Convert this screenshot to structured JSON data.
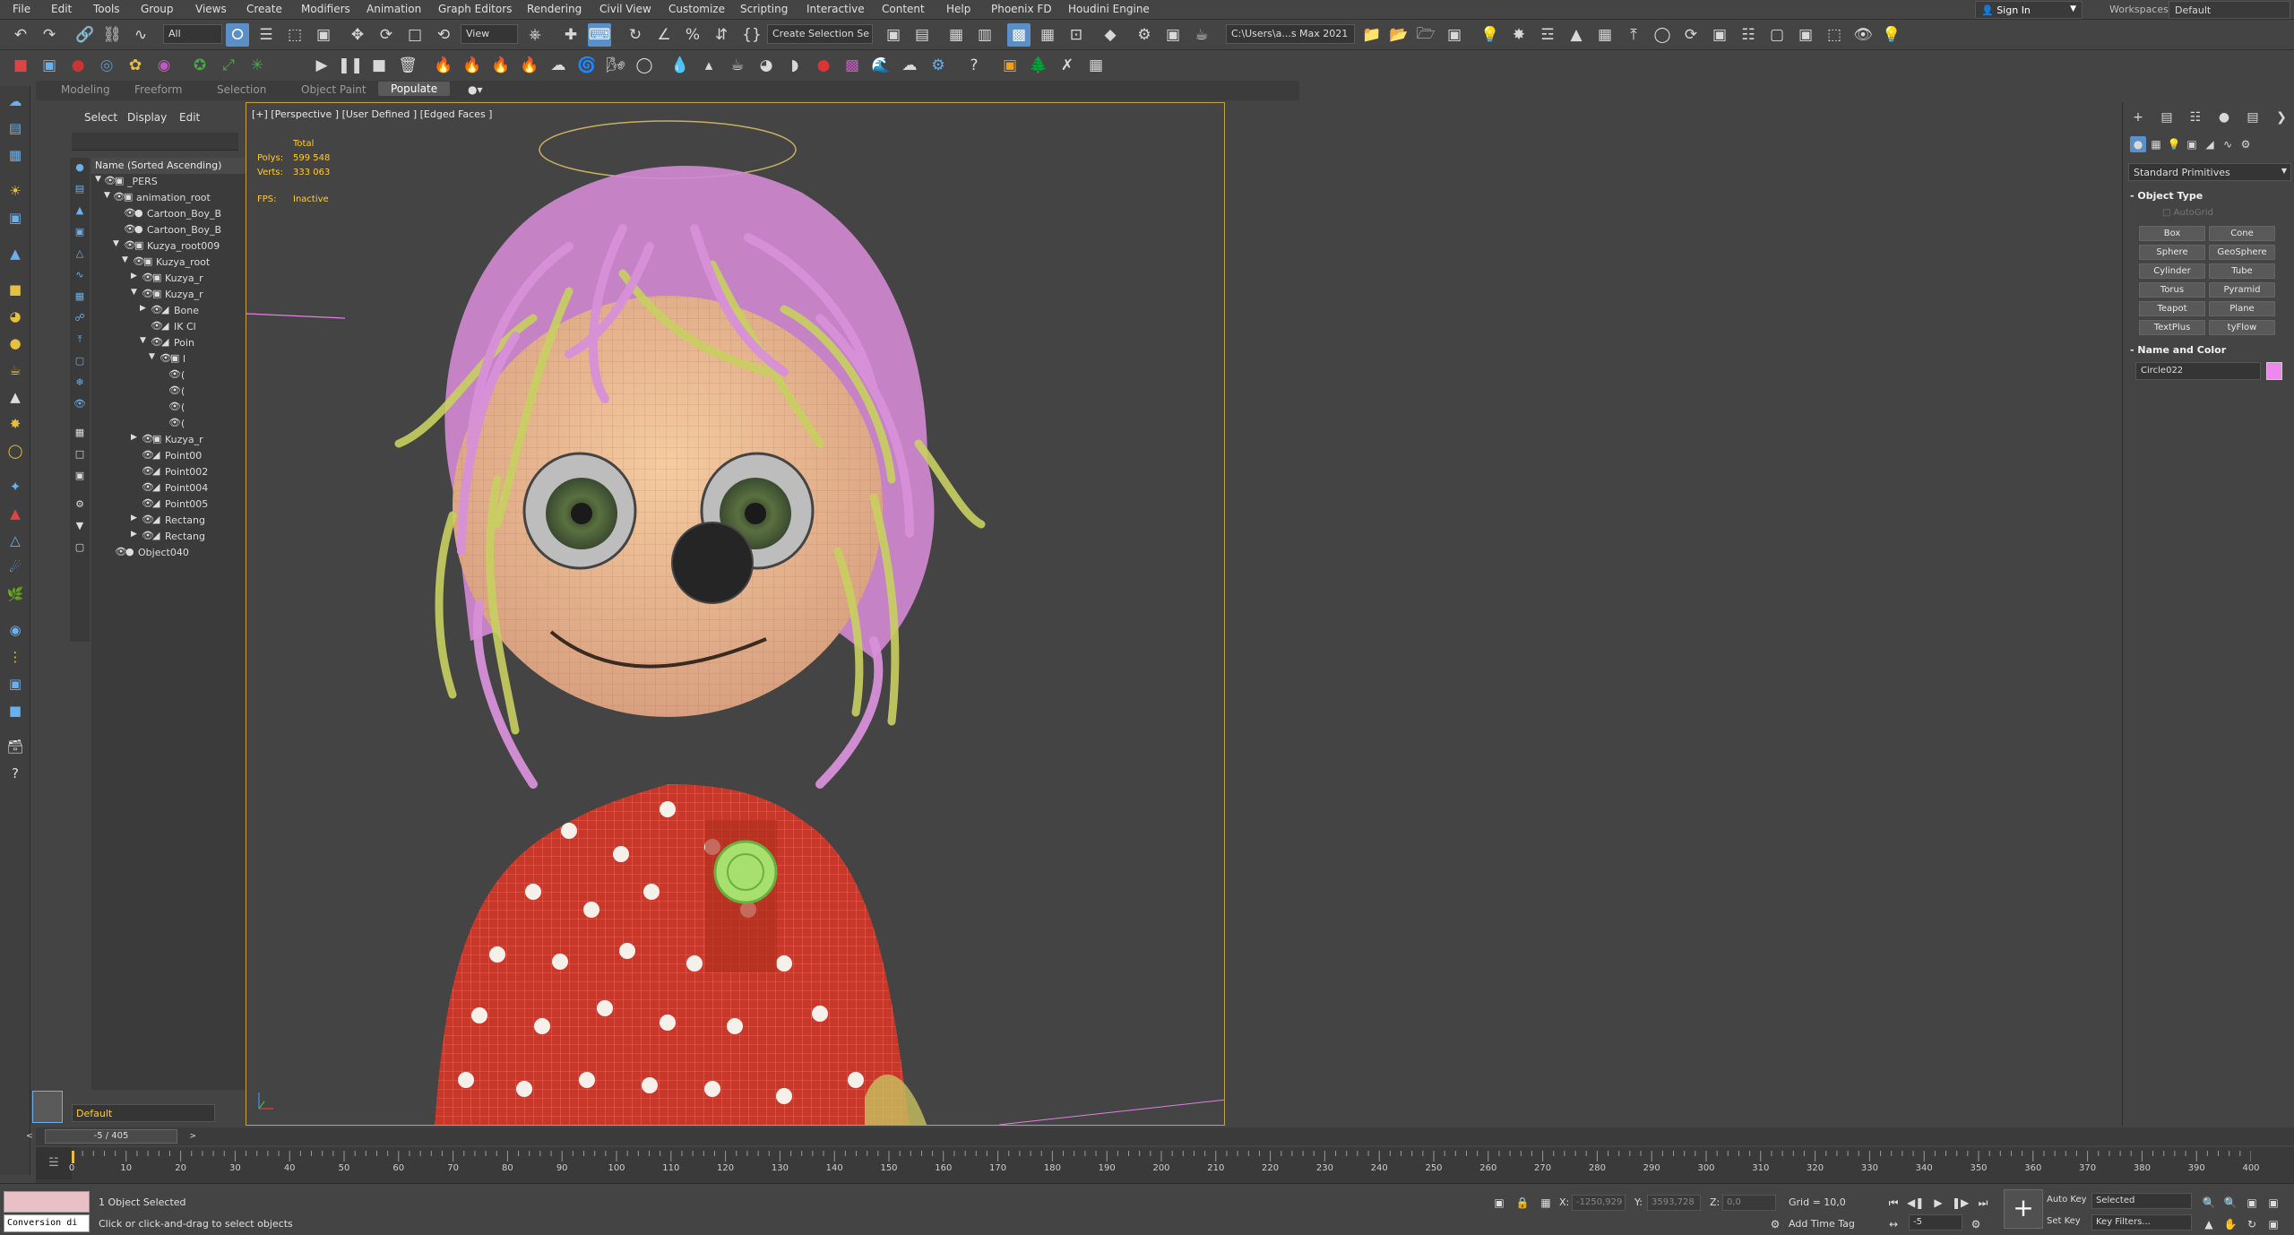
{
  "menubar": {
    "items": [
      "File",
      "Edit",
      "Tools",
      "Group",
      "Views",
      "Create",
      "Modifiers",
      "Animation",
      "Graph Editors",
      "Rendering",
      "Civil View",
      "Customize",
      "Scripting",
      "Interactive",
      "Content",
      "Help",
      "Phoenix FD",
      "Houdini Engine"
    ],
    "sign_in": "Sign In",
    "workspaces_label": "Workspaces:",
    "workspace_value": "Default"
  },
  "toolbar": {
    "filter_value": "All",
    "reference_coord": "View",
    "named_selection": "Create Selection Se",
    "project_path": "C:\\Users\\a...s Max 2021"
  },
  "ribbon": {
    "tabs": [
      "Modeling",
      "Freeform",
      "Selection",
      "Object Paint",
      "Populate"
    ],
    "active_tab": "Populate"
  },
  "scene_explorer": {
    "tabs": [
      "Select",
      "Display",
      "Edit"
    ],
    "header": "Name (Sorted Ascending)",
    "rows": [
      {
        "label": "_PERS"
      },
      {
        "label": "animation_root"
      },
      {
        "label": "Cartoon_Boy_B"
      },
      {
        "label": "Cartoon_Boy_B"
      },
      {
        "label": "Kuzya_root009"
      },
      {
        "label": "Kuzya_root"
      },
      {
        "label": "Kuzya_r"
      },
      {
        "label": "Kuzya_r"
      },
      {
        "label": "Bone"
      },
      {
        "label": "IK Cl"
      },
      {
        "label": "Poin"
      },
      {
        "label": "l"
      },
      {
        "label": "("
      },
      {
        "label": "("
      },
      {
        "label": "("
      },
      {
        "label": "("
      },
      {
        "label": "Kuzya_r"
      },
      {
        "label": "Point00"
      },
      {
        "label": "Point002"
      },
      {
        "label": "Point004"
      },
      {
        "label": "Point005"
      },
      {
        "label": "Rectang"
      },
      {
        "label": "Rectang"
      },
      {
        "label": "Object040"
      }
    ],
    "layer": "Default"
  },
  "viewport": {
    "label": "[+] [Perspective ] [User Defined ] [Edged Faces ]",
    "stats": {
      "total_label": "Total",
      "polys_label": "Polys:",
      "polys_value": "599 548",
      "verts_label": "Verts:",
      "verts_value": "333 063",
      "fps_label": "FPS:",
      "fps_value": "Inactive"
    }
  },
  "command_panel": {
    "primitive_type": "Standard Primitives",
    "object_type_title": "Object Type",
    "autogrid": "AutoGrid",
    "buttons": [
      "Box",
      "Cone",
      "Sphere",
      "GeoSphere",
      "Cylinder",
      "Tube",
      "Torus",
      "Pyramid",
      "Teapot",
      "Plane",
      "TextPlus",
      "tyFlow"
    ],
    "name_color_title": "Name and Color",
    "object_name": "Circle022",
    "object_color": "#ee88ee"
  },
  "timeline": {
    "frame_display": "-5 / 405",
    "ticks": [
      "0",
      "10",
      "20",
      "30",
      "40",
      "50",
      "60",
      "70",
      "80",
      "90",
      "100",
      "110",
      "120",
      "130",
      "140",
      "150",
      "160",
      "170",
      "180",
      "190",
      "200",
      "210",
      "220",
      "230",
      "240",
      "250",
      "260",
      "270",
      "280",
      "290",
      "300",
      "310",
      "320",
      "330",
      "340",
      "350",
      "360",
      "370",
      "380",
      "390",
      "400"
    ]
  },
  "statusbar": {
    "listener_text": "Conversion di",
    "selection_status": "1 Object Selected",
    "prompt": "Click or click-and-drag to select objects",
    "x_label": "X:",
    "x_value": "-1250,929",
    "y_label": "Y:",
    "y_value": "3593,728",
    "z_label": "Z:",
    "z_value": "0,0",
    "grid": "Grid = 10,0",
    "add_time_tag": "Add Time Tag",
    "auto_key": "Auto Key",
    "set_key": "Set Key",
    "selected_set": "Selected",
    "key_filters": "Key Filters...",
    "current_frame": "-5"
  }
}
